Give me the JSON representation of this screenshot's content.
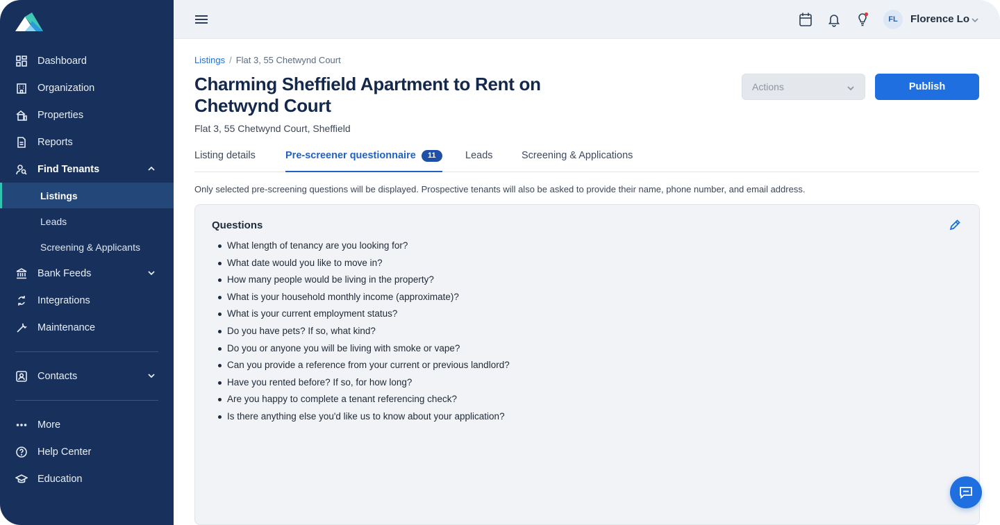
{
  "sidebar": {
    "nav": [
      {
        "label": "Dashboard",
        "icon": "dashboard-icon"
      },
      {
        "label": "Organization",
        "icon": "building-icon"
      },
      {
        "label": "Properties",
        "icon": "properties-icon"
      },
      {
        "label": "Reports",
        "icon": "report-icon"
      },
      {
        "label": "Find Tenants",
        "icon": "find-tenants-icon"
      }
    ],
    "sub": [
      "Listings",
      "Leads",
      "Screening & Applicants"
    ],
    "nav2": [
      {
        "label": "Bank Feeds",
        "icon": "bank-icon"
      },
      {
        "label": "Integrations",
        "icon": "integrations-icon"
      },
      {
        "label": "Maintenance",
        "icon": "wrench-icon"
      }
    ],
    "contacts": "Contacts",
    "more": "More",
    "help": "Help Center",
    "education": "Education"
  },
  "topbar": {
    "avatar_initials": "FL",
    "user_name": "Florence Lo"
  },
  "breadcrumb": {
    "root": "Listings",
    "separator": "/",
    "current": "Flat 3, 55 Chetwynd Court"
  },
  "listing": {
    "title": "Charming Sheffield Apartment to Rent on Chetwynd Court",
    "address": "Flat 3, 55 Chetwynd Court, Sheffield"
  },
  "buttons": {
    "actions": "Actions",
    "publish": "Publish"
  },
  "tabs": {
    "details": "Listing details",
    "prescreener": "Pre-screener questionnaire",
    "prescreener_count": "11",
    "leads": "Leads",
    "screening": "Screening & Applications"
  },
  "info_text": "Only selected pre-screening questions will be displayed. Prospective tenants will also be asked to provide their name, phone number, and email address.",
  "questions": {
    "title": "Questions",
    "items": [
      "What length of tenancy are you looking for?",
      "What date would you like to move in?",
      "How many people would be living in the property?",
      "What is your household monthly income (approximate)?",
      "What is your current employment status?",
      "Do you have pets? If so, what kind?",
      "Do you or anyone you will be living with smoke or vape?",
      "Can you provide a reference from your current or previous landlord?",
      "Have you rented before? If so, for how long?",
      "Are you happy to complete a tenant referencing check?",
      "Is there anything else you'd like us to know about your application?"
    ]
  },
  "colors": {
    "sidebar_bg": "#17315c",
    "accent": "#1f6fe0",
    "active_marker": "#2fc4b2"
  }
}
